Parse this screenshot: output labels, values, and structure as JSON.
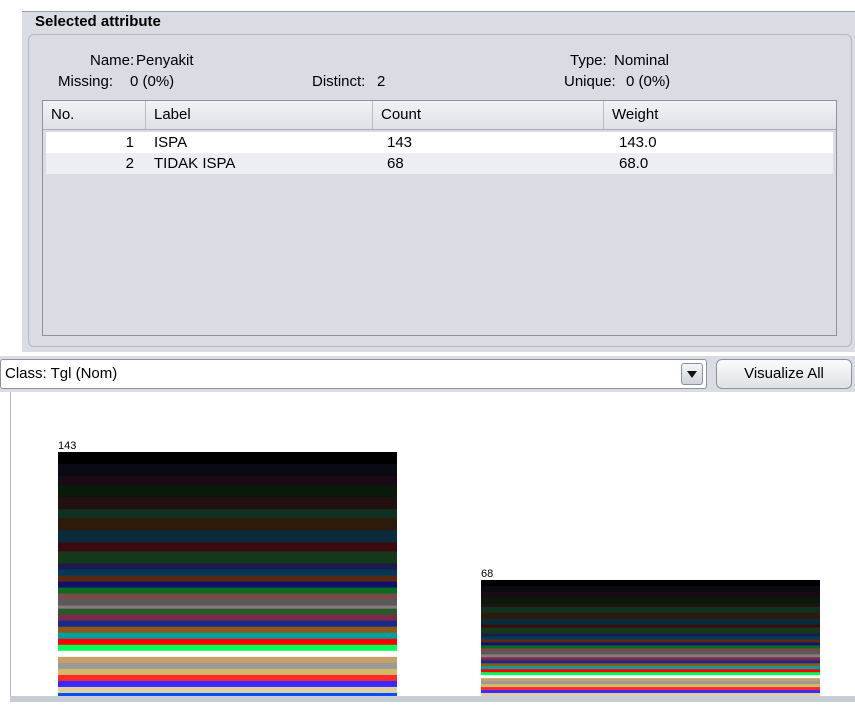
{
  "selected_attribute": {
    "title": "Selected attribute",
    "name_label": "Name:",
    "name_value": "Penyakit",
    "type_label": "Type:",
    "type_value": "Nominal",
    "missing_label": "Missing:",
    "missing_value": "0 (0%)",
    "distinct_label": "Distinct:",
    "distinct_value": "2",
    "unique_label": "Unique:",
    "unique_value": "0 (0%)"
  },
  "table": {
    "headers": [
      "No.",
      "Label",
      "Count",
      "Weight"
    ],
    "rows": [
      {
        "no": "1",
        "label": "ISPA",
        "count": "143",
        "weight": "143.0"
      },
      {
        "no": "2",
        "label": "TIDAK ISPA",
        "count": "68",
        "weight": "68.0"
      }
    ]
  },
  "class_selector": {
    "value": "Class: Tgl (Nom)",
    "dropdown_icon": "chevron-down-icon"
  },
  "visualize_all_label": "Visualize All",
  "chart_data": {
    "type": "bar",
    "categories": [
      "ISPA",
      "TIDAK ISPA"
    ],
    "values": [
      143,
      68
    ],
    "value_labels": [
      "143",
      "68"
    ],
    "ylim": [
      0,
      143
    ],
    "stacked_by_class": true,
    "palette": [
      "#000000",
      "#0a0a14",
      "#1a0a14",
      "#0a1a0a",
      "#231010",
      "#103020",
      "#2d1a0a",
      "#0a2c3a",
      "#3a0a10",
      "#16381a",
      "#1b1b4d",
      "#003a5a",
      "#5a2a10",
      "#12126e",
      "#0a6b1f",
      "#7a4a4a",
      "#5a5a5a",
      "#8a7a7a",
      "#2a5a2a",
      "#7a2a4a",
      "#1a2a8a",
      "#8a5a1a",
      "#00a0a0",
      "#ff0000",
      "#00ff5a",
      "#ffffff",
      "#c8a06a",
      "#9a9a9a",
      "#d4b86a",
      "#ff2a2a",
      "#3a2aff",
      "#e0d0a0",
      "#0050ff"
    ]
  }
}
